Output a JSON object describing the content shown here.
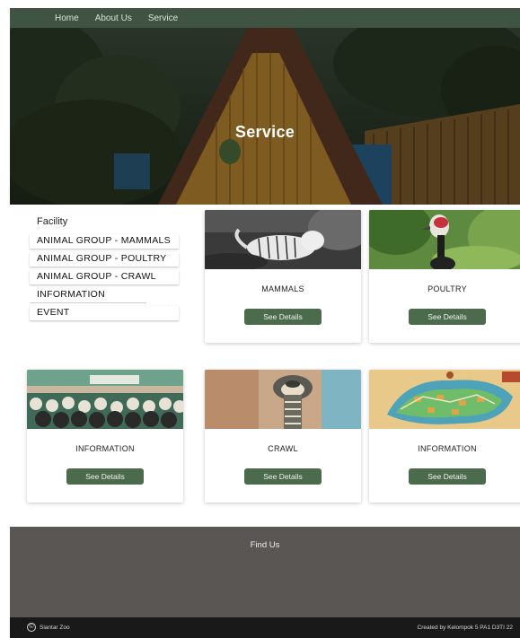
{
  "nav": {
    "items": [
      {
        "label": "Home"
      },
      {
        "label": "About Us"
      },
      {
        "label": "Service"
      }
    ]
  },
  "hero": {
    "title": "Service"
  },
  "facility": {
    "title": "Facility",
    "items": [
      {
        "label": "ANIMAL GROUP - MAMMALS"
      },
      {
        "label": "ANIMAL GROUP - POULTRY"
      },
      {
        "label": "ANIMAL GROUP -  CRAWL"
      },
      {
        "label": "INFORMATION"
      },
      {
        "label": "EVENT"
      }
    ]
  },
  "cards": [
    {
      "label": "MAMMALS",
      "button": "See Details"
    },
    {
      "label": "POULTRY",
      "button": "See Details"
    },
    {
      "label": "INFORMATION",
      "button": "See Details"
    },
    {
      "label": "CRAWL",
      "button": "See Details"
    },
    {
      "label": "INFORMATION",
      "button": "See Details"
    }
  ],
  "footer": {
    "title": "Find Us",
    "copyright_icon": "copyright-icon",
    "copyright": "Siantar Zoo",
    "credit": "Created by Kelompok 5 PA1 D3TI 22"
  },
  "colors": {
    "nav_bg": "#405443",
    "button_bg": "#4c6a4c",
    "footer_bg": "#5a5654",
    "bottom_bar_bg": "#191919"
  }
}
